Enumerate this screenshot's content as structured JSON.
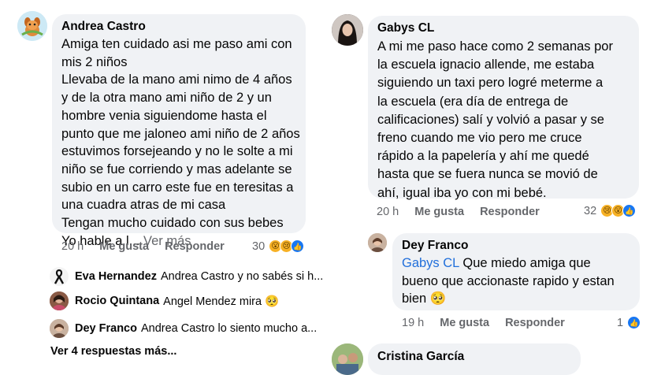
{
  "left_comment": {
    "author": "Andrea Castro",
    "lines": [
      "Amiga ten cuidado asi me paso ami con",
      "mis 2 niños",
      "Llevaba de la mano ami nimo de 4 años",
      "y de la otra mano ami niño de 2 y un",
      "hombre venia siguiendome hasta el",
      "punto que me jaloneo ami niño de 2 años",
      "estuvimos forsejeando y no le solte a mi",
      "niño se fue corriendo y mas adelante se",
      "subio en un carro este fue en teresitas a",
      "una cuadra atras de mi casa",
      "Tengan mucho cuidado con sus bebes"
    ],
    "last_line": "Yo hable a l...",
    "see_more": "Ver más",
    "time": "20 h",
    "like": "Me gusta",
    "reply": "Responder",
    "reaction_count": "30"
  },
  "left_replies": [
    {
      "name": "Eva Hernandez",
      "text": "Andrea Castro y no sabés si h..."
    },
    {
      "name": "Rocio Quintana",
      "text": "Angel Mendez mira 🥺"
    },
    {
      "name": "Dey Franco",
      "text": "Andrea Castro lo siento mucho a..."
    }
  ],
  "left_see_more_replies": "Ver 4 respuestas más...",
  "right_comment": {
    "author": "Gabys CL",
    "lines": [
      "A mi me paso hace como 2 semanas por",
      "la escuela ignacio allende, me estaba",
      "siguiendo un taxi pero logré meterme a",
      "la escuela (era día de entrega de",
      "calificaciones) salí y volvió a pasar y se",
      "freno cuando me vio pero me cruce",
      "rápido a la papelería y ahí me quedé",
      "hasta que se fuera nunca se movió de",
      "ahí, igual iba yo con mi bebé."
    ],
    "time": "20 h",
    "like": "Me gusta",
    "reply": "Responder",
    "reaction_count": "32"
  },
  "right_reply": {
    "author": "Dey Franco",
    "mention": "Gabys CL",
    "line1": "Que miedo amiga que",
    "line2": "bueno que accionaste rapido y estan",
    "line3": "bien 🥺",
    "time": "19 h",
    "like": "Me gusta",
    "reply": "Responder",
    "reaction_count": "1"
  },
  "bottom_comment": {
    "author": "Cristina García"
  }
}
